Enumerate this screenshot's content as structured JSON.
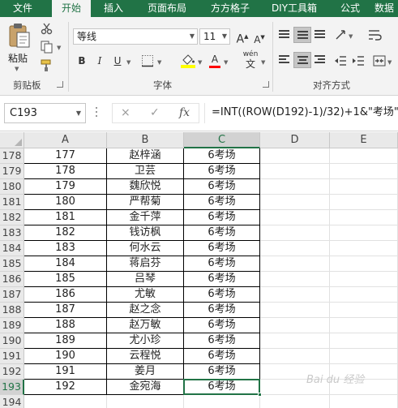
{
  "menu": {
    "tabs": [
      "文件",
      "开始",
      "插入",
      "页面布局",
      "方方格子",
      "DIY工具箱",
      "公式",
      "数据"
    ],
    "active_index": 1
  },
  "ribbon": {
    "clipboard": {
      "paste_label": "粘贴",
      "group_label": "剪贴板"
    },
    "font": {
      "font_name": "等线",
      "font_size": "11",
      "bold": "B",
      "italic": "I",
      "underline": "U",
      "group_label": "字体",
      "font_color_glyph": "A",
      "wen_glyph": "wén",
      "wen_char": "文"
    },
    "alignment": {
      "group_label": "对齐方式"
    }
  },
  "formula_bar": {
    "name_box": "C193",
    "cancel_glyph": "×",
    "enter_glyph": "✓",
    "fx_glyph": "fx",
    "formula": "=INT((ROW(D192)-1)/32)+1&\"考场\""
  },
  "grid": {
    "columns": [
      "A",
      "B",
      "C",
      "D",
      "E"
    ],
    "selected_column": "C",
    "selected_row": "193",
    "rows": [
      {
        "row": "178",
        "a": "177",
        "b": "赵梓涵",
        "c": "6考场"
      },
      {
        "row": "179",
        "a": "178",
        "b": "卫芸",
        "c": "6考场"
      },
      {
        "row": "180",
        "a": "179",
        "b": "魏欣悦",
        "c": "6考场"
      },
      {
        "row": "181",
        "a": "180",
        "b": "严帮菊",
        "c": "6考场"
      },
      {
        "row": "182",
        "a": "181",
        "b": "金千萍",
        "c": "6考场"
      },
      {
        "row": "183",
        "a": "182",
        "b": "钱访枫",
        "c": "6考场"
      },
      {
        "row": "184",
        "a": "183",
        "b": "何水云",
        "c": "6考场"
      },
      {
        "row": "185",
        "a": "184",
        "b": "蒋启芬",
        "c": "6考场"
      },
      {
        "row": "186",
        "a": "185",
        "b": "吕琴",
        "c": "6考场"
      },
      {
        "row": "187",
        "a": "186",
        "b": "尤敏",
        "c": "6考场"
      },
      {
        "row": "188",
        "a": "187",
        "b": "赵之念",
        "c": "6考场"
      },
      {
        "row": "189",
        "a": "188",
        "b": "赵万敏",
        "c": "6考场"
      },
      {
        "row": "190",
        "a": "189",
        "b": "尤小珍",
        "c": "6考场"
      },
      {
        "row": "191",
        "a": "190",
        "b": "云程悦",
        "c": "6考场"
      },
      {
        "row": "192",
        "a": "191",
        "b": "姜月",
        "c": "6考场"
      },
      {
        "row": "193",
        "a": "192",
        "b": "金宛海",
        "c": "6考场"
      },
      {
        "row": "194",
        "a": "",
        "b": "",
        "c": ""
      }
    ]
  },
  "watermark": "Bai du 经验",
  "colors": {
    "excel_green": "#217346",
    "ribbon_bg": "#f3f3f3",
    "header_bg": "#e9e9e9"
  }
}
